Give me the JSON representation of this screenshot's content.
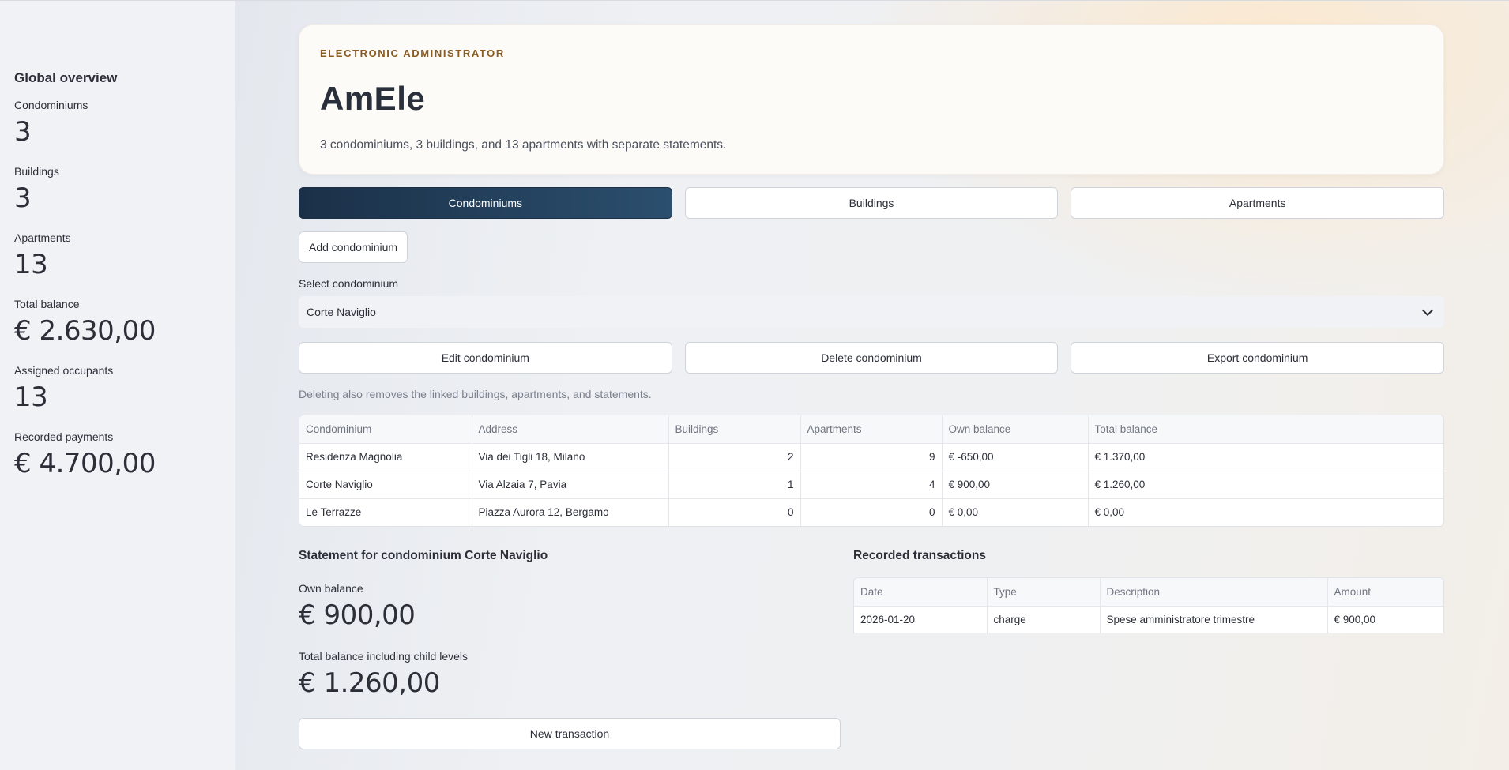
{
  "sidebar": {
    "title": "Global overview",
    "metrics": [
      {
        "label": "Condominiums",
        "value": "3"
      },
      {
        "label": "Buildings",
        "value": "3"
      },
      {
        "label": "Apartments",
        "value": "13"
      },
      {
        "label": "Total balance",
        "value": "€ 2.630,00"
      },
      {
        "label": "Assigned occupants",
        "value": "13"
      },
      {
        "label": "Recorded payments",
        "value": "€ 4.700,00"
      }
    ]
  },
  "hero": {
    "kicker": "ELECTRONIC ADMINISTRATOR",
    "title": "AmEle",
    "subtitle": "3 condominiums, 3 buildings, and 13 apartments with separate statements."
  },
  "tabs": [
    {
      "label": "Condominiums",
      "active": true
    },
    {
      "label": "Buildings",
      "active": false
    },
    {
      "label": "Apartments",
      "active": false
    }
  ],
  "add_button": "Add condominium",
  "select": {
    "label": "Select condominium",
    "value": "Corte Naviglio"
  },
  "actions": {
    "edit": "Edit condominium",
    "delete": "Delete condominium",
    "export": "Export condominium"
  },
  "delete_note": "Deleting also removes the linked buildings, apartments, and statements.",
  "condo_table": {
    "columns": [
      "Condominium",
      "Address",
      "Buildings",
      "Apartments",
      "Own balance",
      "Total balance"
    ],
    "rows": [
      [
        "Residenza Magnolia",
        "Via dei Tigli 18, Milano",
        "2",
        "9",
        "€ -650,00",
        "€ 1.370,00"
      ],
      [
        "Corte Naviglio",
        "Via Alzaia 7, Pavia",
        "1",
        "4",
        "€ 900,00",
        "€ 1.260,00"
      ],
      [
        "Le Terrazze",
        "Piazza Aurora 12, Bergamo",
        "0",
        "0",
        "€ 0,00",
        "€ 0,00"
      ]
    ]
  },
  "statement": {
    "title": "Statement for condominium Corte Naviglio",
    "own_label": "Own balance",
    "own_value": "€ 900,00",
    "total_label": "Total balance including child levels",
    "total_value": "€ 1.260,00",
    "new_tx": "New transaction"
  },
  "transactions": {
    "title": "Recorded transactions",
    "columns": [
      "Date",
      "Type",
      "Description",
      "Amount"
    ],
    "rows": [
      [
        "2026-01-20",
        "charge",
        "Spese amministratore trimestre",
        "€ 900,00"
      ]
    ]
  }
}
